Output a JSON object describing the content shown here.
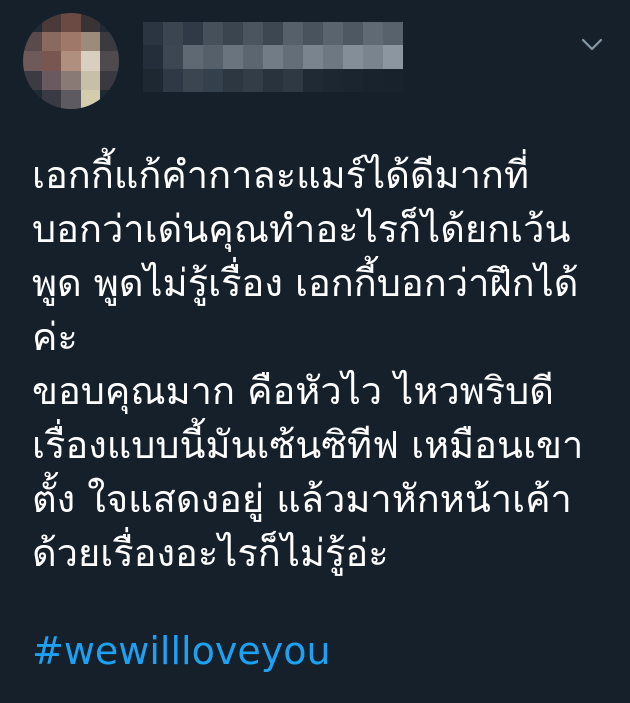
{
  "colors": {
    "background": "#15202b",
    "text": "#ffffff",
    "link": "#1da1f2",
    "chevron": "#8899a6"
  },
  "header": {
    "menu_icon": "chevron-down-icon"
  },
  "tweet": {
    "lines": [
      "เอกกี้แก้คำกาละแมร์ได้ดีมากที่",
      "บอกว่าเด่นคุณทำอะไรก็ได้ยกเว้น",
      "พูด พูดไม่รู้เรื่อง เอกกี้บอกว่าฝึกได้",
      "ค่ะ",
      "ขอบคุณมาก คือหัวไว ไหวพริบดี",
      "เรื่องแบบนี้มันเซ้นซิทีฟ เหมือนเขา",
      "ตั้ง ใจแสดงอยู่ แล้วมาหักหน้าเค้า",
      "ด้วยเรื่องอะไรก็ไม่รู้อ่ะ"
    ],
    "hashtag": "#wewillloveyou"
  }
}
